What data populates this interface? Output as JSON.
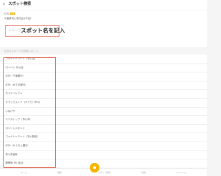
{
  "header": {
    "back_icon": "‹",
    "title": "スポット検索"
  },
  "form": {
    "address_label": "住所",
    "required_badge": "必須",
    "address_value": "千葉県市川市付近1丁目2",
    "name_placeholder": "スポット名",
    "name_annotation": "スポット名を記入"
  },
  "results": {
    "count_text": "近辺のスポットを検索しました。",
    "items": [
      "ファミリーマート（市川店）",
      "ローソン 市川店",
      "ATM（千葉銀行）",
      "ATM（みずほ銀行）",
      "セブンイレブン",
      "ドラッグストア（マツモト市川）",
      "いなげや",
      "ミニストップ（市川市）",
      "ガソリンスタンド",
      "ファミリーマート（市川駅前）",
      "ATM（ゆうちょ銀行）",
      "市川市役所",
      "郵便局 市川支店"
    ]
  },
  "bottom_nav": {
    "tab_home": "ホーム",
    "tab_map": "地図",
    "tab_spot": "スポット登録",
    "tab_post": "投稿",
    "tab_mypage": "マイページ"
  },
  "colors": {
    "annotation_border": "#e05a47",
    "accent": "#f5b400"
  }
}
